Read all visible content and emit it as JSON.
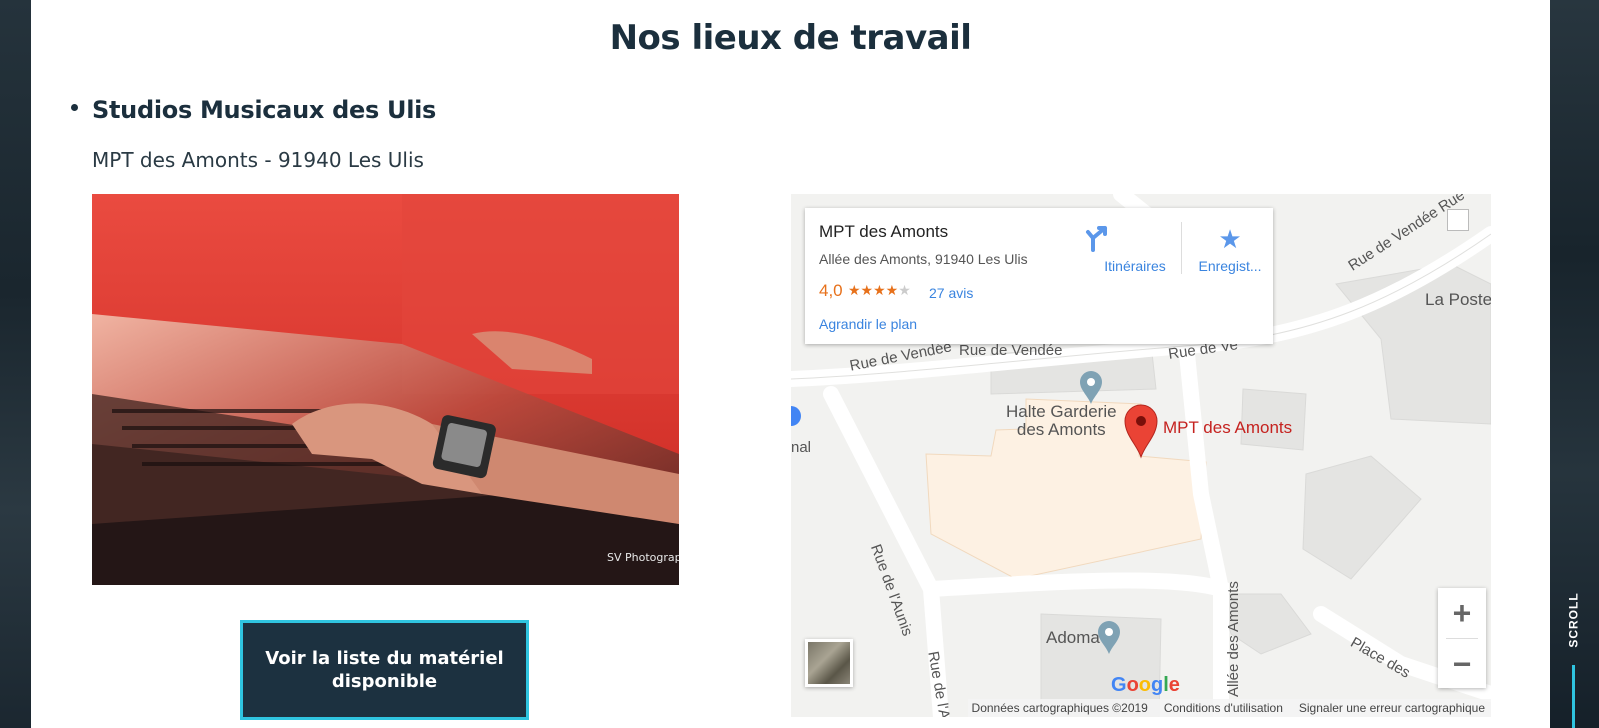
{
  "page": {
    "title": "Nos lieux de travail",
    "scroll_label": "SCROLL"
  },
  "venue": {
    "name": "Studios Musicaux des Ulis",
    "address": "MPT des Amonts - 91940 Les Ulis",
    "photo_watermark": "SV Photography",
    "button_label": "Voir la liste du matériel disponible"
  },
  "map": {
    "card": {
      "place_name": "MPT des Amonts",
      "place_address": "Allée des Amonts, 91940 Les Ulis",
      "rating": "4,0",
      "stars_filled": 4,
      "stars_total": 5,
      "reviews": "27 avis",
      "enlarge_link": "Agrandir le plan",
      "directions_label": "Itinéraires",
      "save_label": "Enregist..."
    },
    "labels": {
      "street_vendee_1": "Rue de Vendée",
      "street_vendee_2": "Rue de Vendée",
      "street_vendee_3": "Rue de Vendée Rue",
      "street_vendee_4": "Rue de Ve",
      "street_aunis_1": "Rue de l'Aunis",
      "street_aunis_2": "Rue de l'A",
      "street_amonts": "Allée des Amonts",
      "street_place": "Place des",
      "poi_halte": "Halte Garderie des Amonts",
      "poi_halte_line1": "Halte Garderie",
      "poi_halte_line2": "des Amonts",
      "poi_mpt": "MPT des Amonts",
      "poi_adoma": "Adoma",
      "poi_poste": "La Poste",
      "poi_edge": "nal"
    },
    "attribution": {
      "data": "Données cartographiques ©2019",
      "terms": "Conditions d'utilisation",
      "report": "Signaler une erreur cartographique"
    },
    "google_logo": "Google",
    "zoom_in": "+",
    "zoom_out": "−"
  },
  "colors": {
    "navy": "#1b2f3d",
    "accent_cyan": "#2fc4e0",
    "button_bg": "#1c3140",
    "map_link_blue": "#3a84df",
    "rating_orange": "#e7711b",
    "pin_red": "#ea4335"
  }
}
